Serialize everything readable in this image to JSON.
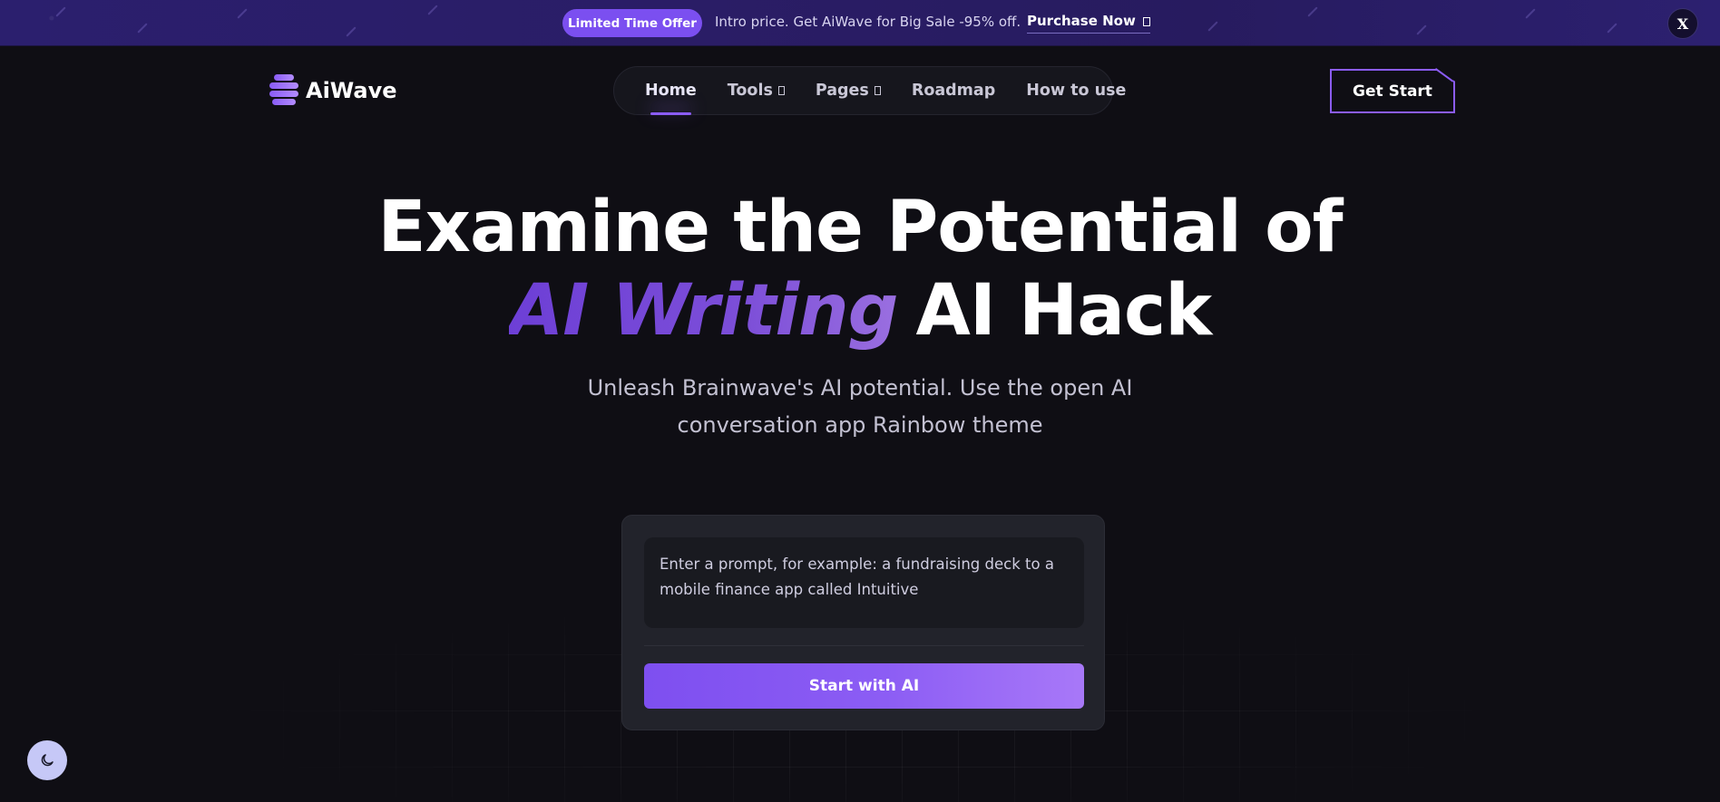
{
  "promo": {
    "badge": "Limited Time Offer",
    "text": "Intro price. Get AiWave for Big Sale -95% off.",
    "link": "Purchase Now",
    "close": "X"
  },
  "header": {
    "logo_text": "AiWave",
    "nav": [
      {
        "label": "Home",
        "active": true
      },
      {
        "label": "Tools",
        "dropdown": true
      },
      {
        "label": "Pages",
        "dropdown": true
      },
      {
        "label": "Roadmap"
      },
      {
        "label": "How to use"
      }
    ],
    "cta": "Get Start"
  },
  "hero": {
    "line1": "Examine the Potential of",
    "highlight": "AI Writing",
    "line2_rest": "AI Hack",
    "subtitle": "Unleash Brainwave's AI potential. Use the open AI conversation app Rainbow theme"
  },
  "prompt": {
    "text": "Enter a prompt, for example: a fundraising deck to a mobile finance app called Intuitive",
    "button": "Start with AI"
  },
  "icons": {
    "theme_toggle": "moon-icon",
    "logo": "layers-logo-icon",
    "dropdown": "chevron-down-icon",
    "external": "arrow-right-icon"
  },
  "colors": {
    "accent": "#8b5cf6",
    "background": "#0f0e14",
    "promo_bg": "#2a1d66"
  }
}
